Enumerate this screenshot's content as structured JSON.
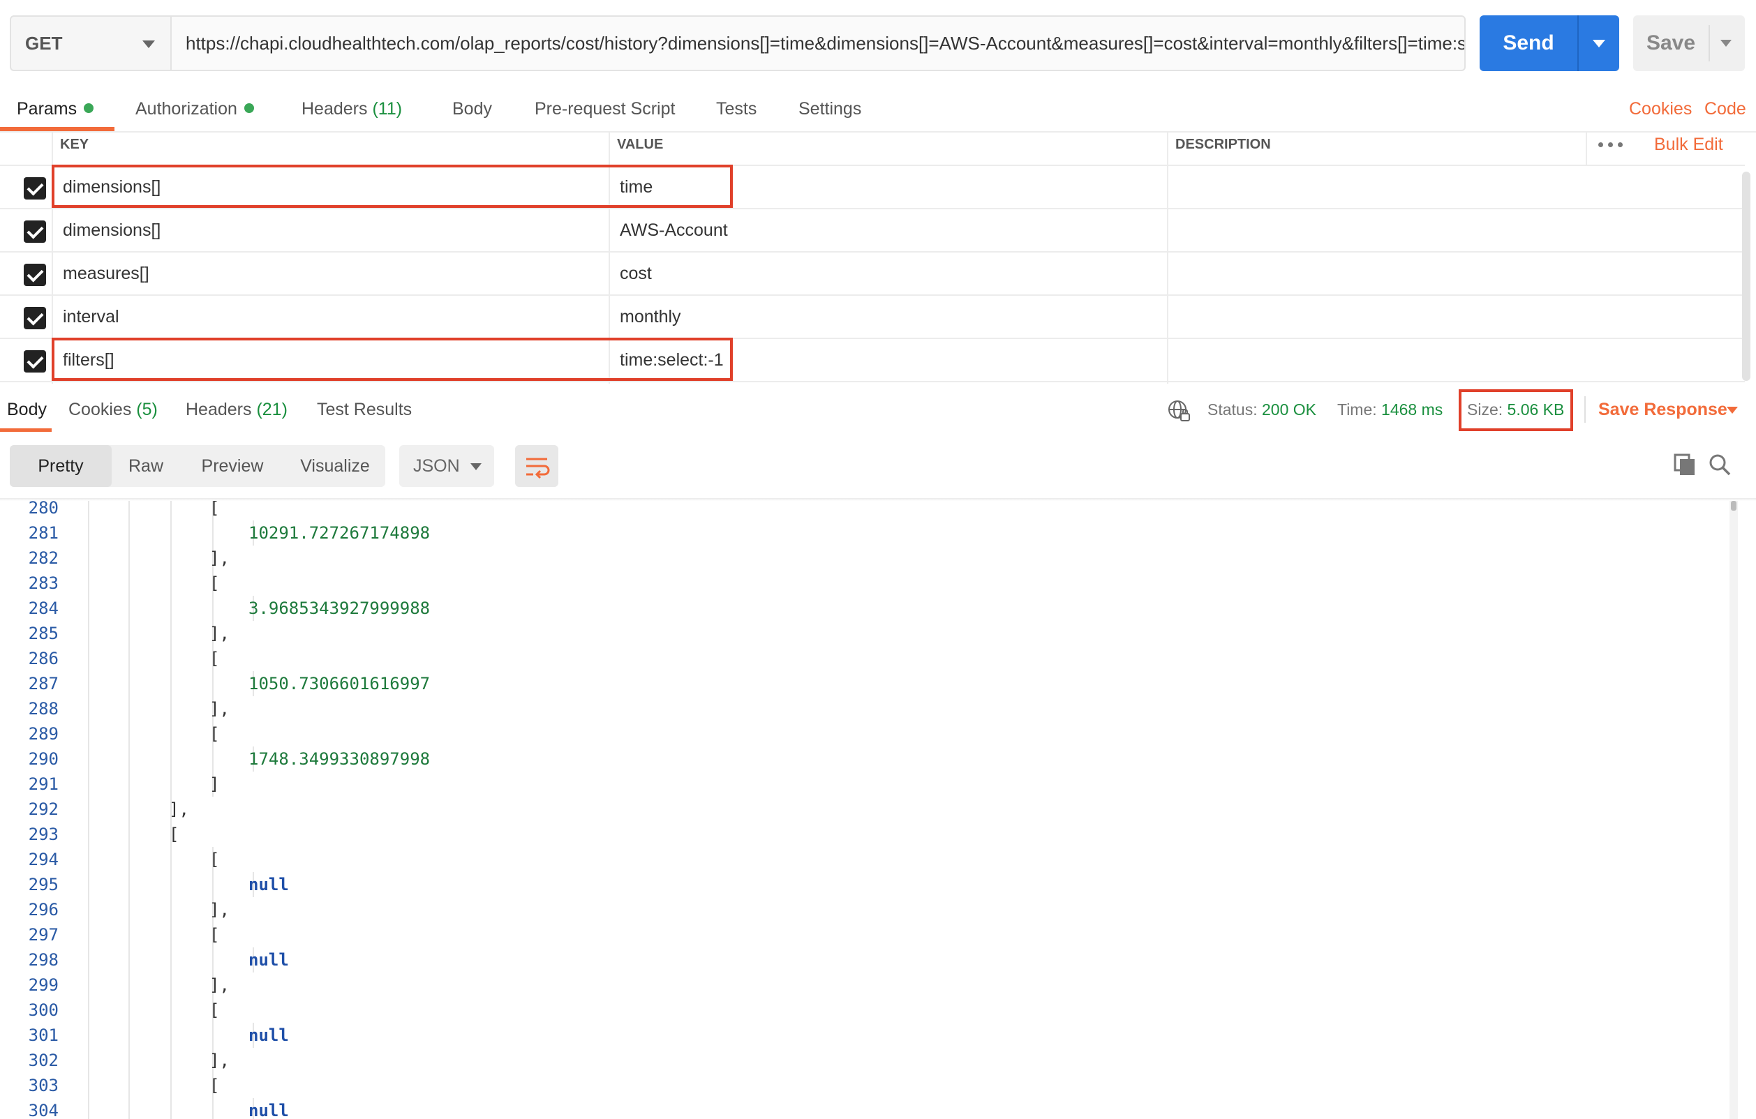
{
  "request": {
    "method": "GET",
    "url": "https://chapi.cloudhealthtech.com/olap_reports/cost/history?dimensions[]=time&dimensions[]=AWS-Account&measures[]=cost&interval=monthly&filters[]=time:s​",
    "send_label": "Send",
    "save_label": "Save"
  },
  "request_tabs": {
    "params": "Params",
    "authorization": "Authorization",
    "headers": "Headers",
    "headers_count": "(11)",
    "body": "Body",
    "prerequest": "Pre-request Script",
    "tests": "Tests",
    "settings": "Settings",
    "cookies_link": "Cookies",
    "code_link": "Code"
  },
  "params_table": {
    "headers": {
      "key": "KEY",
      "value": "VALUE",
      "description": "DESCRIPTION",
      "bulk_edit": "Bulk Edit"
    },
    "rows": [
      {
        "key": "dimensions[]",
        "value": "time",
        "checked": true,
        "highlighted": true
      },
      {
        "key": "dimensions[]",
        "value": "AWS-Account",
        "checked": true,
        "highlighted": false
      },
      {
        "key": "measures[]",
        "value": "cost",
        "checked": true,
        "highlighted": false
      },
      {
        "key": "interval",
        "value": "monthly",
        "checked": true,
        "highlighted": false
      },
      {
        "key": "filters[]",
        "value": "time:select:-1",
        "checked": true,
        "highlighted": true
      }
    ]
  },
  "response_tabs": {
    "body": "Body",
    "cookies": "Cookies",
    "cookies_count": "(5)",
    "headers": "Headers",
    "headers_count": "(21)",
    "test_results": "Test Results"
  },
  "response_meta": {
    "status_label": "Status:",
    "status_value": "200 OK",
    "time_label": "Time:",
    "time_value": "1468 ms",
    "size_label": "Size:",
    "size_value": "5.06 KB",
    "save_response": "Save Response"
  },
  "response_toolbar": {
    "views": [
      "Pretty",
      "Raw",
      "Preview",
      "Visualize"
    ],
    "active_view": "Pretty",
    "format": "JSON"
  },
  "code_lines": [
    {
      "ln": "280",
      "text": "[",
      "indent": 4,
      "type": "punct"
    },
    {
      "ln": "281",
      "text": "10291.727267174898",
      "indent": 5,
      "type": "number"
    },
    {
      "ln": "282",
      "text": "],",
      "indent": 4,
      "type": "punct"
    },
    {
      "ln": "283",
      "text": "[",
      "indent": 4,
      "type": "punct"
    },
    {
      "ln": "284",
      "text": "3.9685343927999988",
      "indent": 5,
      "type": "number"
    },
    {
      "ln": "285",
      "text": "],",
      "indent": 4,
      "type": "punct"
    },
    {
      "ln": "286",
      "text": "[",
      "indent": 4,
      "type": "punct"
    },
    {
      "ln": "287",
      "text": "1050.7306601616997",
      "indent": 5,
      "type": "number"
    },
    {
      "ln": "288",
      "text": "],",
      "indent": 4,
      "type": "punct"
    },
    {
      "ln": "289",
      "text": "[",
      "indent": 4,
      "type": "punct"
    },
    {
      "ln": "290",
      "text": "1748.3499330897998",
      "indent": 5,
      "type": "number"
    },
    {
      "ln": "291",
      "text": "]",
      "indent": 4,
      "type": "punct"
    },
    {
      "ln": "292",
      "text": "],",
      "indent": 3,
      "type": "punct"
    },
    {
      "ln": "293",
      "text": "[",
      "indent": 3,
      "type": "punct"
    },
    {
      "ln": "294",
      "text": "[",
      "indent": 4,
      "type": "punct"
    },
    {
      "ln": "295",
      "text": "null",
      "indent": 5,
      "type": "null"
    },
    {
      "ln": "296",
      "text": "],",
      "indent": 4,
      "type": "punct"
    },
    {
      "ln": "297",
      "text": "[",
      "indent": 4,
      "type": "punct"
    },
    {
      "ln": "298",
      "text": "null",
      "indent": 5,
      "type": "null"
    },
    {
      "ln": "299",
      "text": "],",
      "indent": 4,
      "type": "punct"
    },
    {
      "ln": "300",
      "text": "[",
      "indent": 4,
      "type": "punct"
    },
    {
      "ln": "301",
      "text": "null",
      "indent": 5,
      "type": "null"
    },
    {
      "ln": "302",
      "text": "],",
      "indent": 4,
      "type": "punct"
    },
    {
      "ln": "303",
      "text": "[",
      "indent": 4,
      "type": "punct"
    },
    {
      "ln": "304",
      "text": "null",
      "indent": 5,
      "type": "null"
    }
  ],
  "colors": {
    "accent": "#f26b3a",
    "primary": "#2a7ae2",
    "success": "#1a8f3e",
    "highlight_box": "#e0402a"
  }
}
